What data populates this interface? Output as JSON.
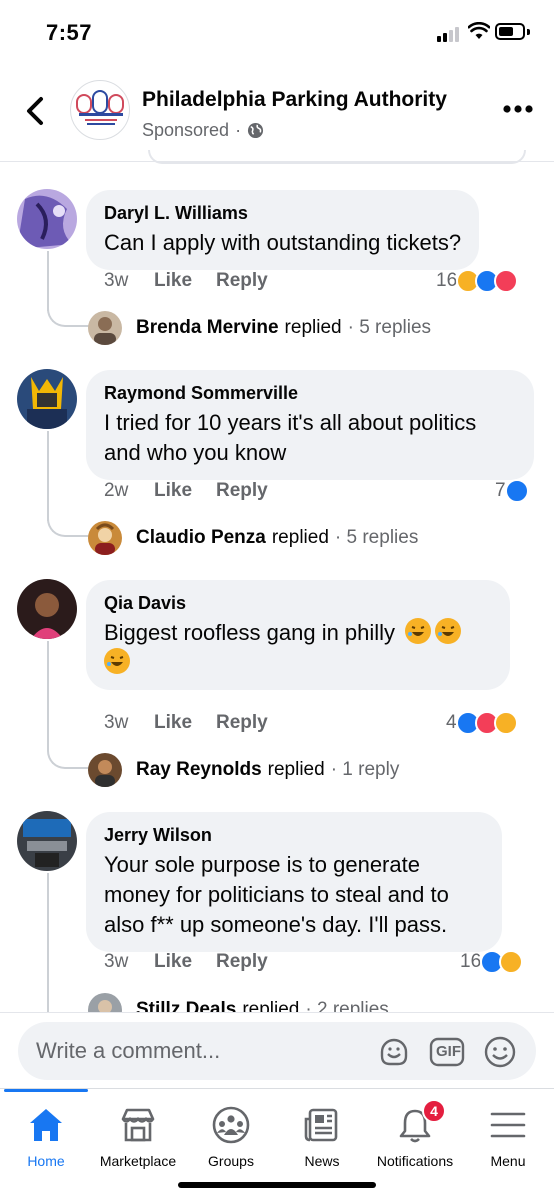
{
  "status_bar": {
    "time": "7:57"
  },
  "post": {
    "page_name": "Philadelphia Parking Authority",
    "sponsored": "Sponsored",
    "separator": "·",
    "logo_text": "PHILADELPHIA Parking Authority"
  },
  "comments": [
    {
      "author": "Daryl L. Williams",
      "text": "Can I apply with outstanding tickets?",
      "age": "3w",
      "like": "Like",
      "reply": "Reply",
      "reaction_count": "16",
      "reactions": [
        "haha-icon",
        "like-icon",
        "love-icon"
      ],
      "reply_preview": {
        "name": "Brenda Mervine",
        "verb": "replied",
        "count": "· 5 replies"
      }
    },
    {
      "author": "Raymond Sommerville",
      "text": "I tried for 10 years it's all about politics and who you know",
      "age": "2w",
      "like": "Like",
      "reply": "Reply",
      "reaction_count": "7",
      "reactions": [
        "like-icon"
      ],
      "reply_preview": {
        "name": "Claudio Penza",
        "verb": "replied",
        "count": "· 5 replies"
      }
    },
    {
      "author": "Qia Davis",
      "text": "Biggest roofless gang in philly",
      "emojis": [
        "rolling-on-floor-laughing-emoji",
        "rolling-on-floor-laughing-emoji",
        "rolling-on-floor-laughing-emoji"
      ],
      "age": "3w",
      "like": "Like",
      "reply": "Reply",
      "reaction_count": "4",
      "reactions": [
        "like-icon",
        "love-icon",
        "haha-icon"
      ],
      "reply_preview": {
        "name": "Ray Reynolds",
        "verb": "replied",
        "count": "· 1 reply"
      }
    },
    {
      "author": "Jerry Wilson",
      "text": "Your sole purpose is to generate money for politicians to steal and to also f** up someone's day. I'll pass.",
      "age": "3w",
      "like": "Like",
      "reply": "Reply",
      "reaction_count": "16",
      "reactions": [
        "like-icon",
        "haha-icon"
      ],
      "reply_preview": {
        "name": "Stillz Deals",
        "verb": "replied",
        "count": "· 2 replies"
      }
    }
  ],
  "composer": {
    "placeholder": "Write a comment...",
    "gif_label": "GIF"
  },
  "tabs": [
    {
      "label": "Home",
      "icon": "home-icon",
      "active": true
    },
    {
      "label": "Marketplace",
      "icon": "marketplace-icon"
    },
    {
      "label": "Groups",
      "icon": "groups-icon"
    },
    {
      "label": "News",
      "icon": "news-icon"
    },
    {
      "label": "Notifications",
      "icon": "bell-icon",
      "badge": "4"
    },
    {
      "label": "Menu",
      "icon": "menu-icon"
    }
  ],
  "colors": {
    "accent": "#1877f2",
    "bubble": "#f0f2f5",
    "secondary_text": "#65676b",
    "badge": "#e41e3f",
    "love": "#f33e58",
    "haha": "#f7b125"
  }
}
